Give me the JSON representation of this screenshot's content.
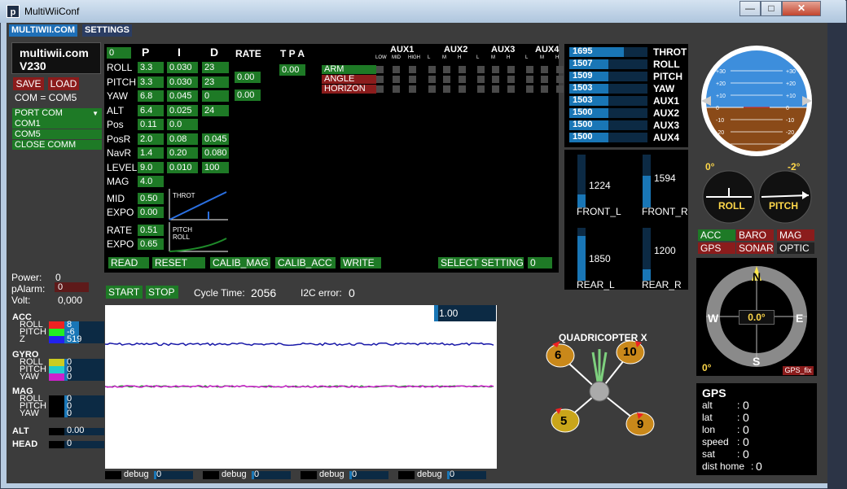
{
  "window": {
    "title": "MultiWiiConf",
    "min": "—",
    "max": "□",
    "close": "✕"
  },
  "tabs": [
    "MULTIWII.COM",
    "SETTINGS"
  ],
  "brand": {
    "line1": "multiwii.com",
    "line2": "V230"
  },
  "buttons": {
    "save": "SAVE",
    "load": "LOAD",
    "read": "READ",
    "reset": "RESET",
    "calib_mag": "CALIB_MAG",
    "calib_acc": "CALIB_ACC",
    "write": "WRITE",
    "select_setting": "SELECT SETTING",
    "start": "START",
    "stop": "STOP"
  },
  "com": {
    "status": "COM = COM5",
    "port_label": "PORT COM",
    "ports": [
      "COM1",
      "COM5"
    ],
    "close": "CLOSE COMM"
  },
  "power": {
    "power_label": "Power:",
    "power_val": "0",
    "palarm_label": "pAlarm:",
    "palarm_val": "0",
    "volt_label": "Volt:",
    "volt_val": "0,000"
  },
  "pid": {
    "setting_val": "0",
    "h_p": "P",
    "h_i": "I",
    "h_d": "D",
    "h_rate": "RATE",
    "h_tpa": "T P A",
    "rows": [
      {
        "name": "ROLL",
        "p": "3.3",
        "i": "0.030",
        "d": "23"
      },
      {
        "name": "PITCH",
        "p": "3.3",
        "i": "0.030",
        "d": "23"
      },
      {
        "name": "YAW",
        "p": "6.8",
        "i": "0.045",
        "d": "0"
      },
      {
        "name": "ALT",
        "p": "6.4",
        "i": "0.025",
        "d": "24"
      },
      {
        "name": "Pos",
        "p": "0.11",
        "i": "0.0",
        "d": ""
      },
      {
        "name": "PosR",
        "p": "2.0",
        "i": "0.08",
        "d": "0.045"
      },
      {
        "name": "NavR",
        "p": "1.4",
        "i": "0.20",
        "d": "0.080"
      },
      {
        "name": "LEVEL",
        "p": "9.0",
        "i": "0.010",
        "d": "100"
      },
      {
        "name": "MAG",
        "p": "4.0",
        "i": "",
        "d": ""
      }
    ],
    "rate_rollpitch": "0.00",
    "rate_yaw": "0.00",
    "tpa": "0.00",
    "throt_label": "THROT",
    "mid_label": "MID",
    "mid_val": "0.50",
    "expo_label": "EXPO",
    "expo_val": "0.00",
    "rate_label": "RATE",
    "rate_val": "0.51",
    "expo2_label": "EXPO",
    "expo2_val": "0.65",
    "pitch_label": "PITCH",
    "roll_label": "ROLL",
    "select_val": "0"
  },
  "aux": {
    "headers": [
      "AUX1",
      "AUX2",
      "AUX3",
      "AUX4"
    ],
    "sub": [
      "LOW",
      "MID",
      "HIGH",
      "L",
      "M",
      "H",
      "L",
      "M",
      "H",
      "L",
      "M",
      "H"
    ],
    "modes": [
      "ARM",
      "ANGLE",
      "HORIZON"
    ]
  },
  "rc": [
    {
      "label": "THROT",
      "value": "1695",
      "frac": 0.7
    },
    {
      "label": "ROLL",
      "value": "1507",
      "frac": 0.5
    },
    {
      "label": "PITCH",
      "value": "1509",
      "frac": 0.5
    },
    {
      "label": "YAW",
      "value": "1503",
      "frac": 0.5
    },
    {
      "label": "AUX1",
      "value": "1503",
      "frac": 0.5
    },
    {
      "label": "AUX2",
      "value": "1500",
      "frac": 0.5
    },
    {
      "label": "AUX3",
      "value": "1500",
      "frac": 0.5
    },
    {
      "label": "AUX4",
      "value": "1500",
      "frac": 0.5
    }
  ],
  "motors": [
    {
      "label": "FRONT_L",
      "value": "1224",
      "frac": 0.25
    },
    {
      "label": "FRONT_R",
      "value": "1594",
      "frac": 0.6
    },
    {
      "label": "REAR_L",
      "value": "1850",
      "frac": 0.85
    },
    {
      "label": "REAR_R",
      "value": "1200",
      "frac": 0.22
    }
  ],
  "horizon": {
    "ticks": [
      "+30",
      "+20",
      "+10",
      "0",
      "-10",
      "-20",
      "-30"
    ],
    "roll_angle": "0°",
    "pitch_angle": "-2°",
    "roll_label": "ROLL",
    "pitch_label": "PITCH"
  },
  "sensors": [
    "ACC",
    "BARO",
    "MAG",
    "GPS",
    "SONAR",
    "OPTIC"
  ],
  "compass": {
    "n": "N",
    "s": "S",
    "e": "E",
    "w": "W",
    "heading": "0.0°",
    "alt_angle": "0°",
    "gps_fix": "GPS_fix"
  },
  "gps": {
    "title": "GPS",
    "rows": [
      {
        "k": "alt",
        "v": "0"
      },
      {
        "k": "lat",
        "v": "0"
      },
      {
        "k": "lon",
        "v": "0"
      },
      {
        "k": "speed",
        "v": "0"
      },
      {
        "k": "sat",
        "v": "0"
      },
      {
        "k": "dist home",
        "v": "0"
      }
    ]
  },
  "cycle": {
    "label": "Cycle Time:",
    "value": "2056",
    "i2c_label": "I2C error:",
    "i2c_value": "0"
  },
  "graph": {
    "scale": "1.00"
  },
  "quad": {
    "title": "QUADRICOPTER X",
    "motors": [
      "6",
      "10",
      "5",
      "9"
    ]
  },
  "left_sensors": {
    "acc": {
      "title": "ACC",
      "rows": [
        {
          "k": "ROLL",
          "v": "8"
        },
        {
          "k": "PITCH",
          "v": "-6"
        },
        {
          "k": "Z",
          "v": "519"
        }
      ]
    },
    "gyro": {
      "title": "GYRO",
      "rows": [
        {
          "k": "ROLL",
          "v": "0"
        },
        {
          "k": "PITCH",
          "v": "0"
        },
        {
          "k": "YAW",
          "v": "0"
        }
      ]
    },
    "mag": {
      "title": "MAG",
      "rows": [
        {
          "k": "ROLL",
          "v": "0"
        },
        {
          "k": "PITCH",
          "v": "0"
        },
        {
          "k": "YAW",
          "v": "0"
        }
      ]
    },
    "alt": {
      "title": "ALT",
      "v": "0.00"
    },
    "head": {
      "title": "HEAD",
      "v": "0"
    }
  },
  "debug": [
    {
      "label": "debug",
      "v": "0"
    },
    {
      "label": "debug",
      "v": "0"
    },
    {
      "label": "debug",
      "v": "0"
    },
    {
      "label": "debug",
      "v": "0"
    }
  ],
  "colors": {
    "green": "#1e7a26",
    "red": "#8b1c1c",
    "blue": "#1976b6",
    "sky": "#3d8edc",
    "ground": "#8a4a18"
  }
}
